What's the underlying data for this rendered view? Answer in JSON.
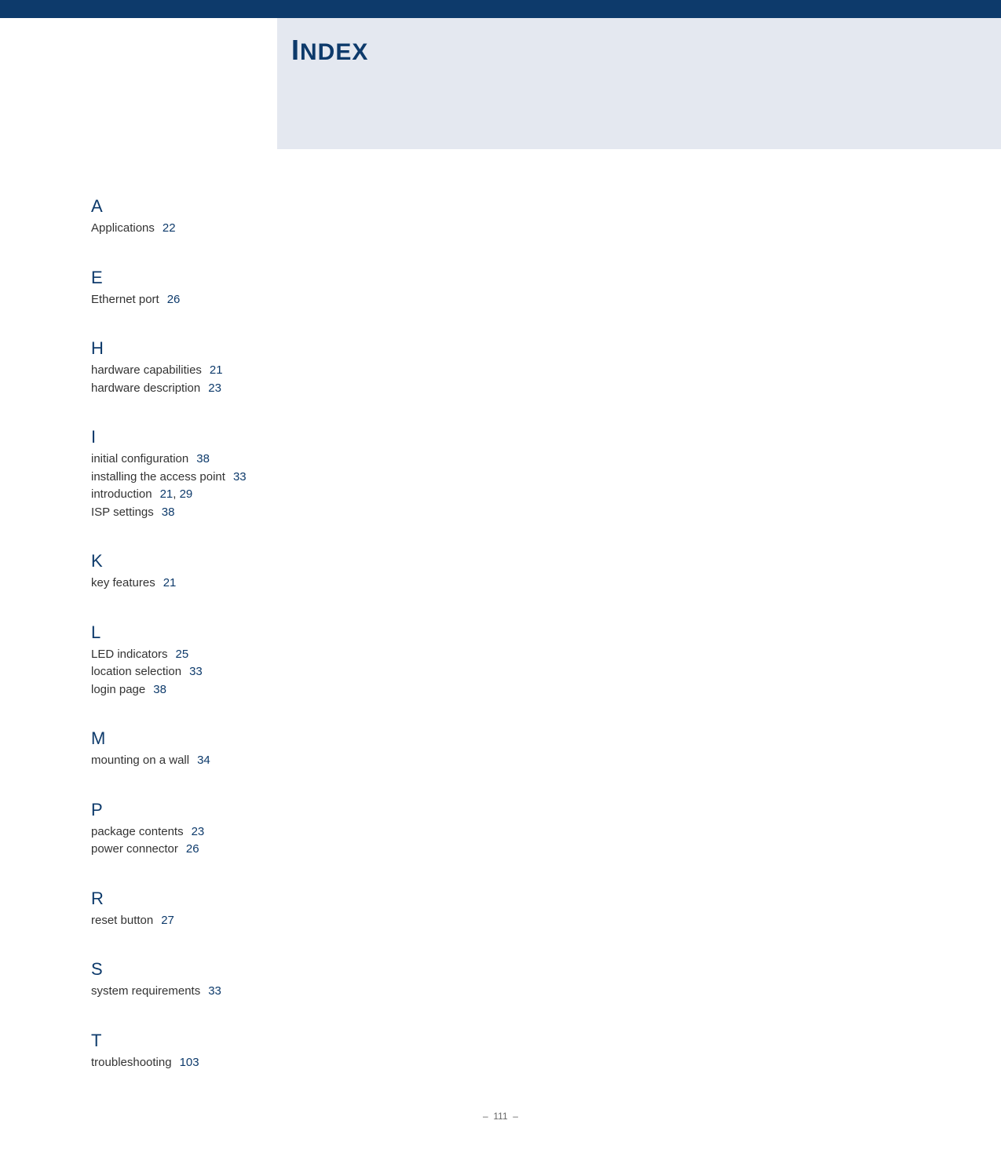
{
  "header": {
    "title_first": "I",
    "title_rest": "NDEX"
  },
  "sections": {
    "A": {
      "letter": "A",
      "e0_term": "Applications",
      "e0_p0": "22"
    },
    "E": {
      "letter": "E",
      "e0_term": "Ethernet port",
      "e0_p0": "26"
    },
    "H": {
      "letter": "H",
      "e0_term": "hardware capabilities",
      "e0_p0": "21",
      "e1_term": "hardware description",
      "e1_p0": "23"
    },
    "I": {
      "letter": "I",
      "e0_term": "initial configuration",
      "e0_p0": "38",
      "e1_term": "installing the access point",
      "e1_p0": "33",
      "e2_term": "introduction",
      "e2_p0": "21",
      "e2_p1": "29",
      "e3_term": "ISP settings",
      "e3_p0": "38"
    },
    "K": {
      "letter": "K",
      "e0_term": "key features",
      "e0_p0": "21"
    },
    "L": {
      "letter": "L",
      "e0_term": "LED indicators",
      "e0_p0": "25",
      "e1_term": "location selection",
      "e1_p0": "33",
      "e2_term": "login page",
      "e2_p0": "38"
    },
    "M": {
      "letter": "M",
      "e0_term": "mounting on a wall",
      "e0_p0": "34"
    },
    "P": {
      "letter": "P",
      "e0_term": "package contents",
      "e0_p0": "23",
      "e1_term": "power connector",
      "e1_p0": "26"
    },
    "R": {
      "letter": "R",
      "e0_term": "reset button",
      "e0_p0": "27"
    },
    "S": {
      "letter": "S",
      "e0_term": "system requirements",
      "e0_p0": "33"
    },
    "T": {
      "letter": "T",
      "e0_term": "troubleshooting",
      "e0_p0": "103"
    }
  },
  "footer": {
    "dash1": "–",
    "page": "111",
    "dash2": "–"
  },
  "comma": ","
}
